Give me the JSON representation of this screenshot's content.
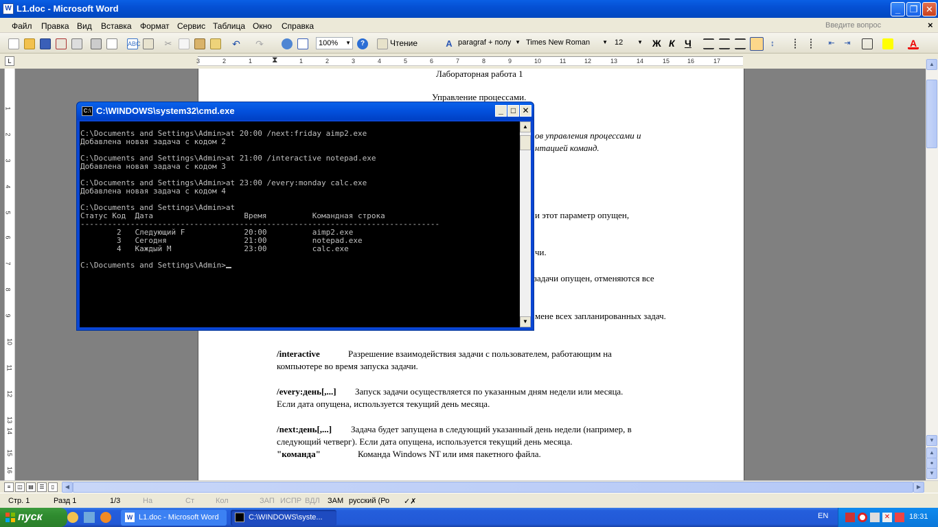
{
  "word": {
    "title": "L1.doc - Microsoft Word",
    "menu": [
      "Файл",
      "Правка",
      "Вид",
      "Вставка",
      "Формат",
      "Сервис",
      "Таблица",
      "Окно",
      "Справка"
    ],
    "ask_placeholder": "Введите вопрос",
    "toolbar": {
      "zoom": "100%",
      "read_label": "Чтение",
      "style": "paragraf + полу",
      "font": "Times New Roman",
      "size": "12",
      "bold": "Ж",
      "italic": "К",
      "underline": "Ч"
    },
    "ruler_numbers": [
      "3",
      "2",
      "1",
      "1",
      "2",
      "3",
      "4",
      "5",
      "6",
      "7",
      "8",
      "9",
      "10",
      "11",
      "12",
      "13",
      "14",
      "15",
      "16",
      "17"
    ],
    "vruler_numbers": [
      "1",
      "2",
      "3",
      "4",
      "5",
      "6",
      "7",
      "8",
      "9",
      "10",
      "11",
      "12",
      "13",
      "14",
      "15",
      "16"
    ],
    "document": {
      "lab_title": "Лабораторная работа 1",
      "subject": "Управление процессами.",
      "goal_line1": "ов управления процессами и",
      "goal_line2": "нтацией команд.",
      "param_line": "и этот параметр опущен,",
      "task_line": "чи.",
      "delete_line": "д задачи опущен, отменяются все",
      "time_line": "мене всех запланированных задач.",
      "interactive_key": "/interactive",
      "interactive_desc1": "Разрешение взаимодействия задачи с пользователем, работающим на",
      "interactive_desc2": "компьютере во время запуска задачи.",
      "every_key": "/every:день[,...]",
      "every_desc1": "Запуск задачи осуществляется по указанным дням недели или месяца.",
      "every_desc2": "Если дата опущена, используется текущий день месяца.",
      "next_key": "/next:день[,...]",
      "next_desc1": "Задача будет запущена в следующий указанный день недели (например, в",
      "next_desc2": "следующий четверг). Если дата опущена, используется текущий день месяца.",
      "command_key": "\"команда\"",
      "command_desc": "Команда Windows NT или имя пакетного файла."
    },
    "status": {
      "page": "Стр. 1",
      "section": "Разд 1",
      "pages": "1/3",
      "at": "На",
      "line": "Ст",
      "col": "Кол",
      "rec": "ЗАП",
      "trk": "ИСПР",
      "ext": "ВДЛ",
      "ovr": "ЗАМ",
      "language": "русский (Ро"
    }
  },
  "cmd": {
    "title": "C:\\WINDOWS\\system32\\cmd.exe",
    "lines": [
      "C:\\Documents and Settings\\Admin>at 20:00 /next:friday aimp2.exe",
      "Добавлена новая задача с кодом 2",
      "",
      "C:\\Documents and Settings\\Admin>at 21:00 /interactive notepad.exe",
      "Добавлена новая задача с кодом 3",
      "",
      "C:\\Documents and Settings\\Admin>at 23:00 /every:monday calc.exe",
      "Добавлена новая задача с кодом 4",
      "",
      "C:\\Documents and Settings\\Admin>at",
      "Статус Код  Дата                    Время          Командная строка",
      "-------------------------------------------------------------------------------",
      "        2   Следующий F             20:00          aimp2.exe",
      "        3   Сегодня                 21:00          notepad.exe",
      "        4   Каждый M                23:00          calc.exe",
      ""
    ],
    "prompt": "C:\\Documents and Settings\\Admin>"
  },
  "taskbar": {
    "start": "пуск",
    "tasks": [
      "L1.doc - Microsoft Word",
      "C:\\WINDOWS\\syste..."
    ],
    "language": "EN",
    "clock": "18:31"
  }
}
